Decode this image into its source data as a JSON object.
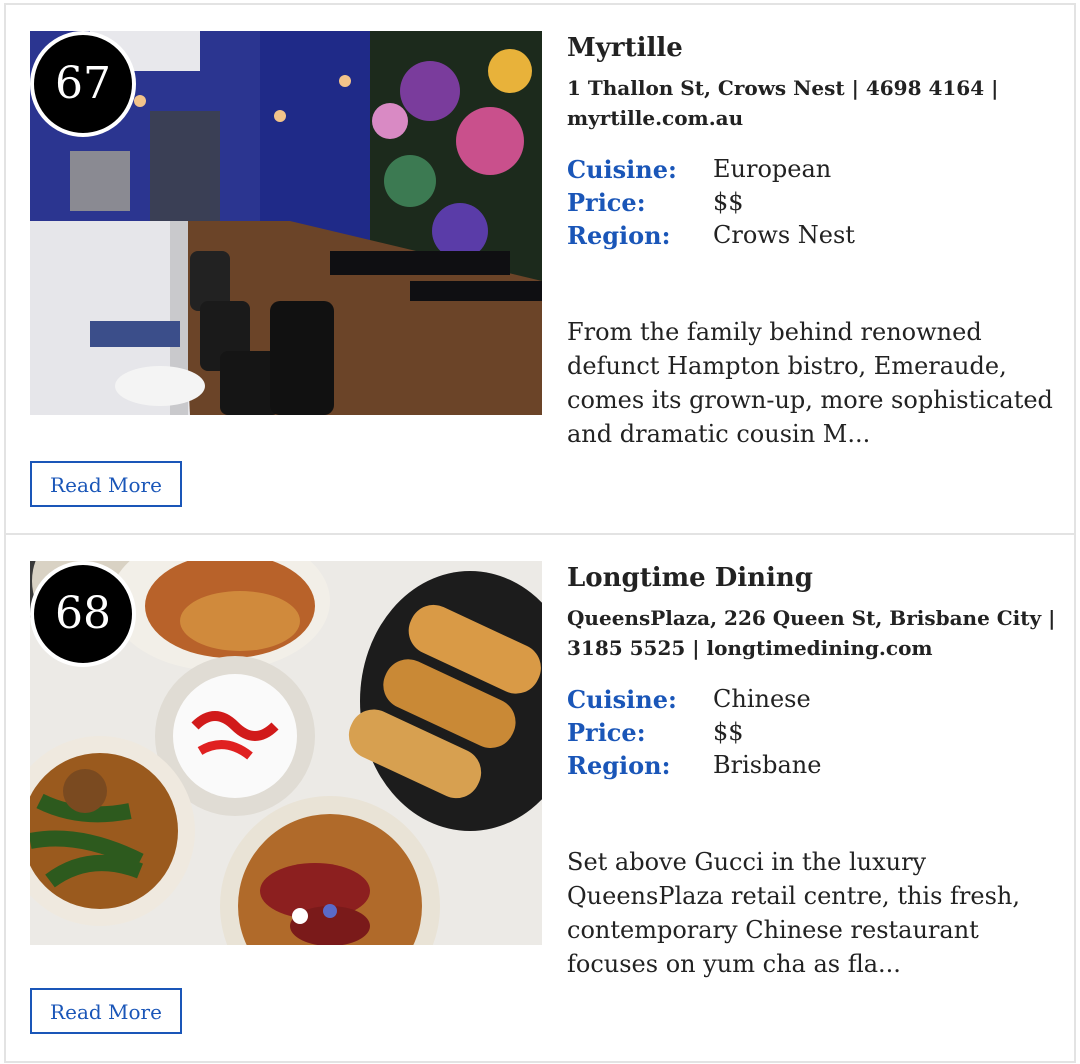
{
  "restaurants": [
    {
      "rank": "67",
      "name": "Myrtille",
      "address": "1 Thallon St, Crows Nest | 4698 4164 | myrtille.com.au",
      "labels": {
        "cuisine": "Cuisine:",
        "price": "Price:",
        "region": "Region:"
      },
      "cuisine": "European",
      "price": "$$",
      "region": "Crows Nest",
      "description": "From the family behind renowned defunct Hampton bistro, Emeraude, comes its grown-up, more sophisticated and dramatic cousin M...",
      "button_label": "Read More"
    },
    {
      "rank": "68",
      "name": "Longtime Dining",
      "address": "QueensPlaza, 226 Queen St, Brisbane City | 3185 5525 | longtimedining.com",
      "labels": {
        "cuisine": "Cuisine:",
        "price": "Price:",
        "region": "Region:"
      },
      "cuisine": "Chinese",
      "price": "$$",
      "region": "Brisbane",
      "description": "Set above Gucci in the luxury QueensPlaza retail centre, this fresh, contemporary Chinese restaurant focuses on yum cha as fla...",
      "button_label": "Read More"
    }
  ],
  "colors": {
    "accent": "#1a56b8",
    "text": "#222222",
    "border": "#e3e3e3"
  }
}
